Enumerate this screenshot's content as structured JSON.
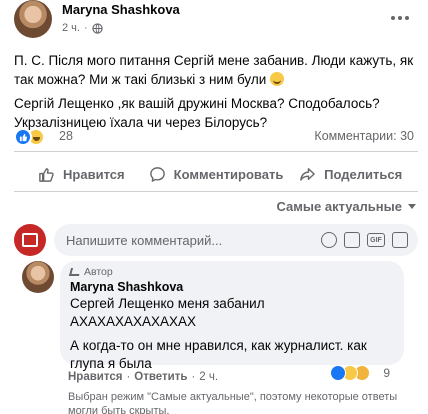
{
  "post": {
    "author": "Maryna Shashkova",
    "time": "2 ч.",
    "paragraph_1": "П. С. Після мого питання Сергій мене забанив. Люди кажуть, як так можна? Ми ж такі близькі з ним були",
    "paragraph_2": "Сергій Лещенко ,як вашій дружині Москва? Сподобалось? Укрзалізницею їхала чи через Білорусь?",
    "reaction_count": "28",
    "comments_count": "Комментарии: 30"
  },
  "actions": {
    "like": "Нравится",
    "comment": "Комментировать",
    "share": "Поделиться"
  },
  "filter": {
    "label": "Самые актуальные"
  },
  "composer": {
    "placeholder": "Напишите комментарий..."
  },
  "comment": {
    "badge": "Автор",
    "author": "Maryna Shashkova",
    "line_1": "Сергей Лещенко меня забанил",
    "line_2": "АХАХАХАХАХАХАХ",
    "line_3": "А когда-то он мне нравился, как журналист. как глупа я была",
    "like_action": "Нравится",
    "separator": "·",
    "reply_action": "Ответить",
    "time": "2 ч.",
    "reaction_count": "9"
  },
  "notice": "Выбран режим \"Самые актуальные\", поэтому некоторые ответы могли быть скрыты.",
  "colors": {
    "accent": "#1877f2",
    "muted_text": "#65676b",
    "bubble": "#f0f2f5"
  }
}
